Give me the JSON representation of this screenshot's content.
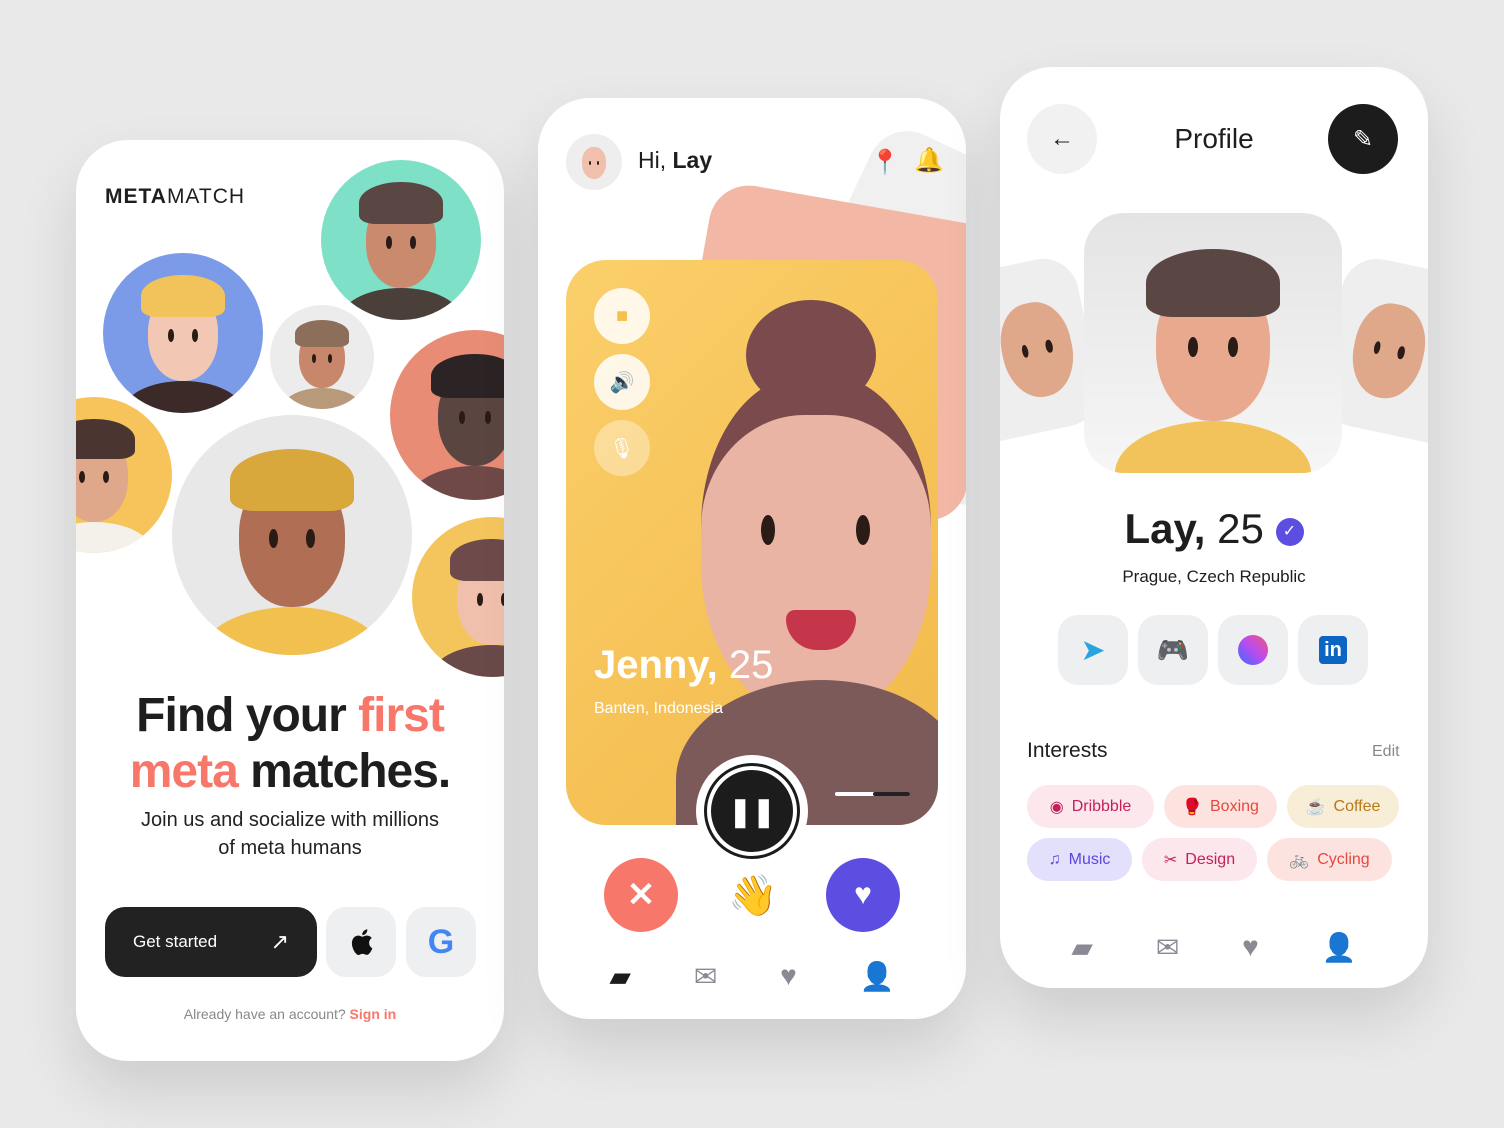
{
  "welcome": {
    "brand_bold": "META",
    "brand_light": "MATCH",
    "title_1": "Find your ",
    "title_accent_1": "first",
    "title_accent_2": "meta",
    "title_2": " matches.",
    "subtitle": "Join us and socialize with millions of meta humans",
    "get_started": "Get started",
    "signin_prompt": "Already have an account? ",
    "signin_link": "Sign in",
    "accent": "#f7776b"
  },
  "call": {
    "greeting": "Hi, ",
    "user": "Lay",
    "name": "Jenny,",
    "age": "25",
    "location": "Banten, Indonesia",
    "progress": 0.5
  },
  "profile": {
    "title": "Profile",
    "name": "Lay,",
    "age": "25",
    "location": "Prague, Czech Republic",
    "socials": [
      "telegram",
      "discord",
      "messenger",
      "linkedin"
    ],
    "interests_label": "Interests",
    "edit_label": "Edit",
    "interests": [
      {
        "label": "Dribbble",
        "icon": "dribbble-icon",
        "bg": "#fbe7ec",
        "color": "#c4215c"
      },
      {
        "label": "Boxing",
        "icon": "boxing-glove-icon",
        "bg": "#fde3e0",
        "color": "#e5493d"
      },
      {
        "label": "Coffee",
        "icon": "coffee-icon",
        "bg": "#f8edd6",
        "color": "#b87916"
      },
      {
        "label": "Music",
        "icon": "music-icon",
        "bg": "#e3e0fb",
        "color": "#5b45e0"
      },
      {
        "label": "Design",
        "icon": "design-icon",
        "bg": "#fbe7ec",
        "color": "#c4215c"
      },
      {
        "label": "Cycling",
        "icon": "bicycle-icon",
        "bg": "#fde3e0",
        "color": "#e5493d"
      }
    ]
  }
}
